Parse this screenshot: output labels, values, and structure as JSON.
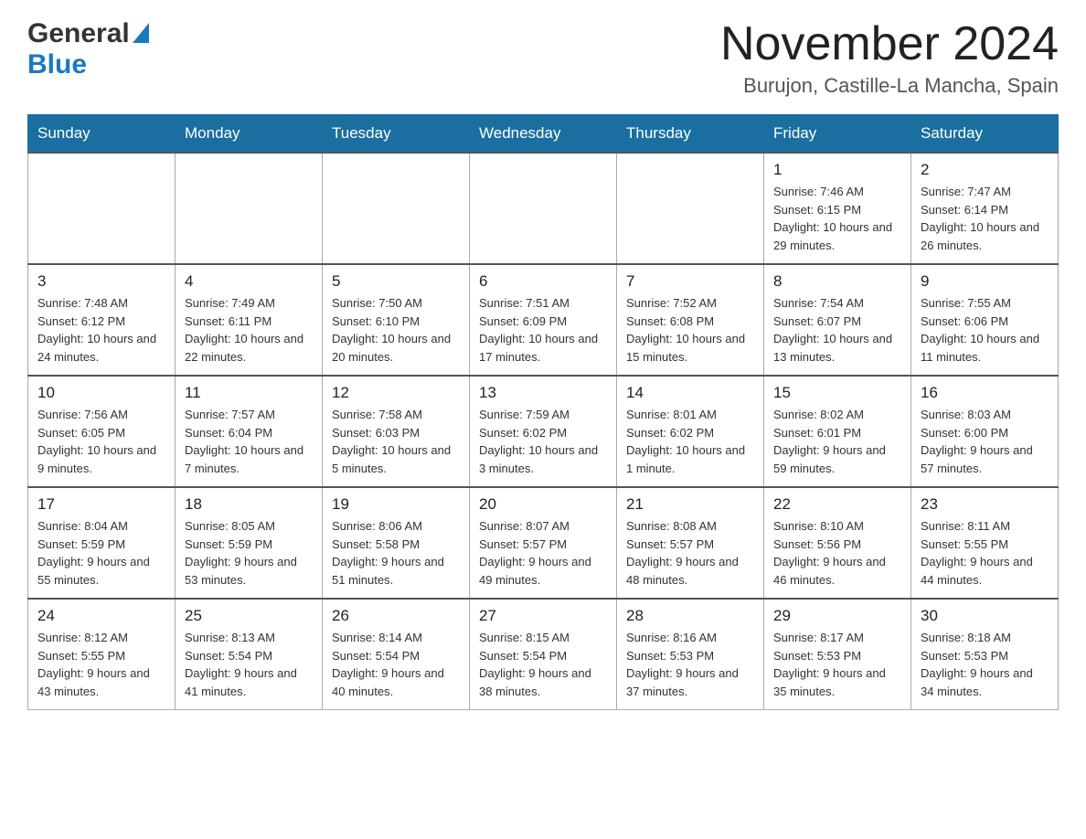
{
  "header": {
    "logo_general": "General",
    "logo_blue": "Blue",
    "month_title": "November 2024",
    "location": "Burujon, Castille-La Mancha, Spain"
  },
  "weekdays": [
    "Sunday",
    "Monday",
    "Tuesday",
    "Wednesday",
    "Thursday",
    "Friday",
    "Saturday"
  ],
  "weeks": [
    [
      {
        "day": "",
        "info": ""
      },
      {
        "day": "",
        "info": ""
      },
      {
        "day": "",
        "info": ""
      },
      {
        "day": "",
        "info": ""
      },
      {
        "day": "",
        "info": ""
      },
      {
        "day": "1",
        "info": "Sunrise: 7:46 AM\nSunset: 6:15 PM\nDaylight: 10 hours and 29 minutes."
      },
      {
        "day": "2",
        "info": "Sunrise: 7:47 AM\nSunset: 6:14 PM\nDaylight: 10 hours and 26 minutes."
      }
    ],
    [
      {
        "day": "3",
        "info": "Sunrise: 7:48 AM\nSunset: 6:12 PM\nDaylight: 10 hours and 24 minutes."
      },
      {
        "day": "4",
        "info": "Sunrise: 7:49 AM\nSunset: 6:11 PM\nDaylight: 10 hours and 22 minutes."
      },
      {
        "day": "5",
        "info": "Sunrise: 7:50 AM\nSunset: 6:10 PM\nDaylight: 10 hours and 20 minutes."
      },
      {
        "day": "6",
        "info": "Sunrise: 7:51 AM\nSunset: 6:09 PM\nDaylight: 10 hours and 17 minutes."
      },
      {
        "day": "7",
        "info": "Sunrise: 7:52 AM\nSunset: 6:08 PM\nDaylight: 10 hours and 15 minutes."
      },
      {
        "day": "8",
        "info": "Sunrise: 7:54 AM\nSunset: 6:07 PM\nDaylight: 10 hours and 13 minutes."
      },
      {
        "day": "9",
        "info": "Sunrise: 7:55 AM\nSunset: 6:06 PM\nDaylight: 10 hours and 11 minutes."
      }
    ],
    [
      {
        "day": "10",
        "info": "Sunrise: 7:56 AM\nSunset: 6:05 PM\nDaylight: 10 hours and 9 minutes."
      },
      {
        "day": "11",
        "info": "Sunrise: 7:57 AM\nSunset: 6:04 PM\nDaylight: 10 hours and 7 minutes."
      },
      {
        "day": "12",
        "info": "Sunrise: 7:58 AM\nSunset: 6:03 PM\nDaylight: 10 hours and 5 minutes."
      },
      {
        "day": "13",
        "info": "Sunrise: 7:59 AM\nSunset: 6:02 PM\nDaylight: 10 hours and 3 minutes."
      },
      {
        "day": "14",
        "info": "Sunrise: 8:01 AM\nSunset: 6:02 PM\nDaylight: 10 hours and 1 minute."
      },
      {
        "day": "15",
        "info": "Sunrise: 8:02 AM\nSunset: 6:01 PM\nDaylight: 9 hours and 59 minutes."
      },
      {
        "day": "16",
        "info": "Sunrise: 8:03 AM\nSunset: 6:00 PM\nDaylight: 9 hours and 57 minutes."
      }
    ],
    [
      {
        "day": "17",
        "info": "Sunrise: 8:04 AM\nSunset: 5:59 PM\nDaylight: 9 hours and 55 minutes."
      },
      {
        "day": "18",
        "info": "Sunrise: 8:05 AM\nSunset: 5:59 PM\nDaylight: 9 hours and 53 minutes."
      },
      {
        "day": "19",
        "info": "Sunrise: 8:06 AM\nSunset: 5:58 PM\nDaylight: 9 hours and 51 minutes."
      },
      {
        "day": "20",
        "info": "Sunrise: 8:07 AM\nSunset: 5:57 PM\nDaylight: 9 hours and 49 minutes."
      },
      {
        "day": "21",
        "info": "Sunrise: 8:08 AM\nSunset: 5:57 PM\nDaylight: 9 hours and 48 minutes."
      },
      {
        "day": "22",
        "info": "Sunrise: 8:10 AM\nSunset: 5:56 PM\nDaylight: 9 hours and 46 minutes."
      },
      {
        "day": "23",
        "info": "Sunrise: 8:11 AM\nSunset: 5:55 PM\nDaylight: 9 hours and 44 minutes."
      }
    ],
    [
      {
        "day": "24",
        "info": "Sunrise: 8:12 AM\nSunset: 5:55 PM\nDaylight: 9 hours and 43 minutes."
      },
      {
        "day": "25",
        "info": "Sunrise: 8:13 AM\nSunset: 5:54 PM\nDaylight: 9 hours and 41 minutes."
      },
      {
        "day": "26",
        "info": "Sunrise: 8:14 AM\nSunset: 5:54 PM\nDaylight: 9 hours and 40 minutes."
      },
      {
        "day": "27",
        "info": "Sunrise: 8:15 AM\nSunset: 5:54 PM\nDaylight: 9 hours and 38 minutes."
      },
      {
        "day": "28",
        "info": "Sunrise: 8:16 AM\nSunset: 5:53 PM\nDaylight: 9 hours and 37 minutes."
      },
      {
        "day": "29",
        "info": "Sunrise: 8:17 AM\nSunset: 5:53 PM\nDaylight: 9 hours and 35 minutes."
      },
      {
        "day": "30",
        "info": "Sunrise: 8:18 AM\nSunset: 5:53 PM\nDaylight: 9 hours and 34 minutes."
      }
    ]
  ]
}
